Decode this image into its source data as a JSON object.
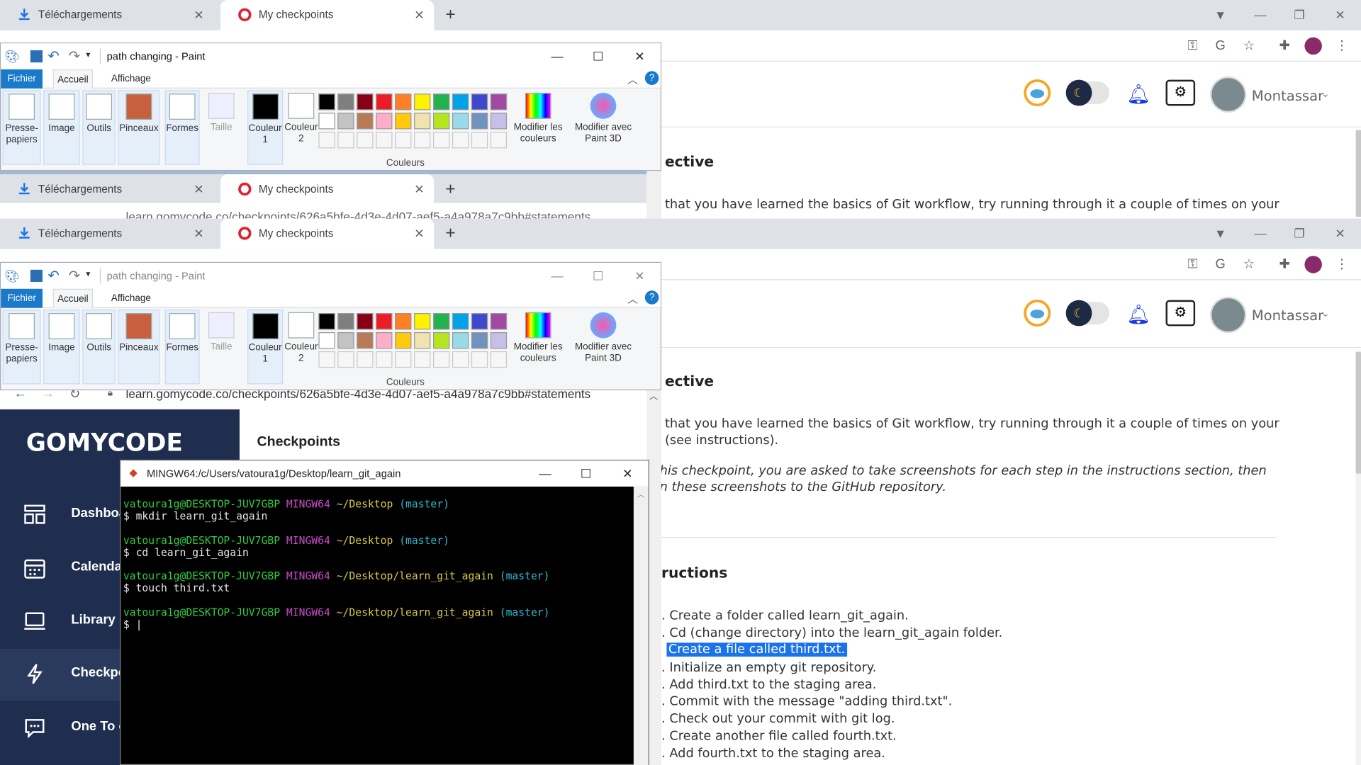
{
  "chrome": {
    "tab_downloads": "Téléchargements",
    "tab_checkpoints": "My checkpoints",
    "url": "learn.gomycode.co/checkpoints/626a5bfe-4d3e-4d07-aef5-a4a978a7c9bb#statements",
    "url_partial_top": "learn.gomycode.co/checkpoints/626a5bfe-4d3e-4d07-aef5-a4a978a7c9bb#statements"
  },
  "paint": {
    "title": "path changing - Paint",
    "tabs": [
      "Fichier",
      "Accueil",
      "Affichage"
    ],
    "groups": {
      "clipboard": "Presse-papiers",
      "image": "Image",
      "tools": "Outils",
      "brushes": "Pinceaux",
      "shapes": "Formes",
      "size": "Taille",
      "color1": "Couleur 1",
      "color2": "Couleur 2",
      "colors": "Couleurs",
      "edit_colors": "Modifier les couleurs",
      "edit_paint3d": "Modifier avec Paint 3D"
    },
    "palette_row1": [
      "#000000",
      "#7f7f7f",
      "#880015",
      "#ed1c24",
      "#ff7f27",
      "#fff200",
      "#22b14c",
      "#00a2e8",
      "#3f48cc",
      "#a349a4"
    ],
    "palette_row2": [
      "#ffffff",
      "#c3c3c3",
      "#b97a57",
      "#ffaec9",
      "#ffc90e",
      "#efe4b0",
      "#b5e61d",
      "#99d9ea",
      "#7092be",
      "#c8bfe7"
    ]
  },
  "header": {
    "user_name": "Montassar"
  },
  "page": {
    "objective_heading": "ective",
    "objective_text_1": "that you have learned the basics of Git workflow, try running through it a couple of times on your",
    "objective_text_2": "(see instructions).",
    "note_text_1": "his checkpoint, you are asked to take screenshots for each step in the instructions section, then",
    "note_text_2": "n these screenshots to the GitHub repository.",
    "instructions_heading": "ructions",
    "instructions": [
      ". Create a folder called learn_git_again.",
      ". Cd (change directory) into the learn_git_again folder.",
      "Create a file called third.txt.",
      ". Initialize an empty git repository.",
      ". Add third.txt to the staging area.",
      ". Commit with the message \"adding third.txt\".",
      ". Check out your commit with git log.",
      ". Create another file called fourth.txt.",
      ". Add fourth.txt to the staging area."
    ],
    "checkpoints_heading": "Checkpoints"
  },
  "sidebar": {
    "brand": "GOMYCODE",
    "items": [
      "Dashboa",
      "Calendar",
      "Library",
      "Checkpo",
      "One To o"
    ]
  },
  "terminal": {
    "title": "MINGW64:/c/Users/vatoura1g/Desktop/learn_git_again",
    "user": "vatoura1g@DESKTOP-JUV7GBP",
    "env": "MINGW64",
    "branch": "(master)",
    "path1": "~/Desktop",
    "path2": "~/Desktop/learn_git_again",
    "cmd1": "$ mkdir learn_git_again",
    "cmd2": "$ cd learn_git_again",
    "cmd3": "$ touch third.txt",
    "prompt": "$ |"
  },
  "colors": {
    "sidebar_bg": "#1f2e4f",
    "paint_file_tab": "#1979ca",
    "highlight": "#1a73e8"
  }
}
